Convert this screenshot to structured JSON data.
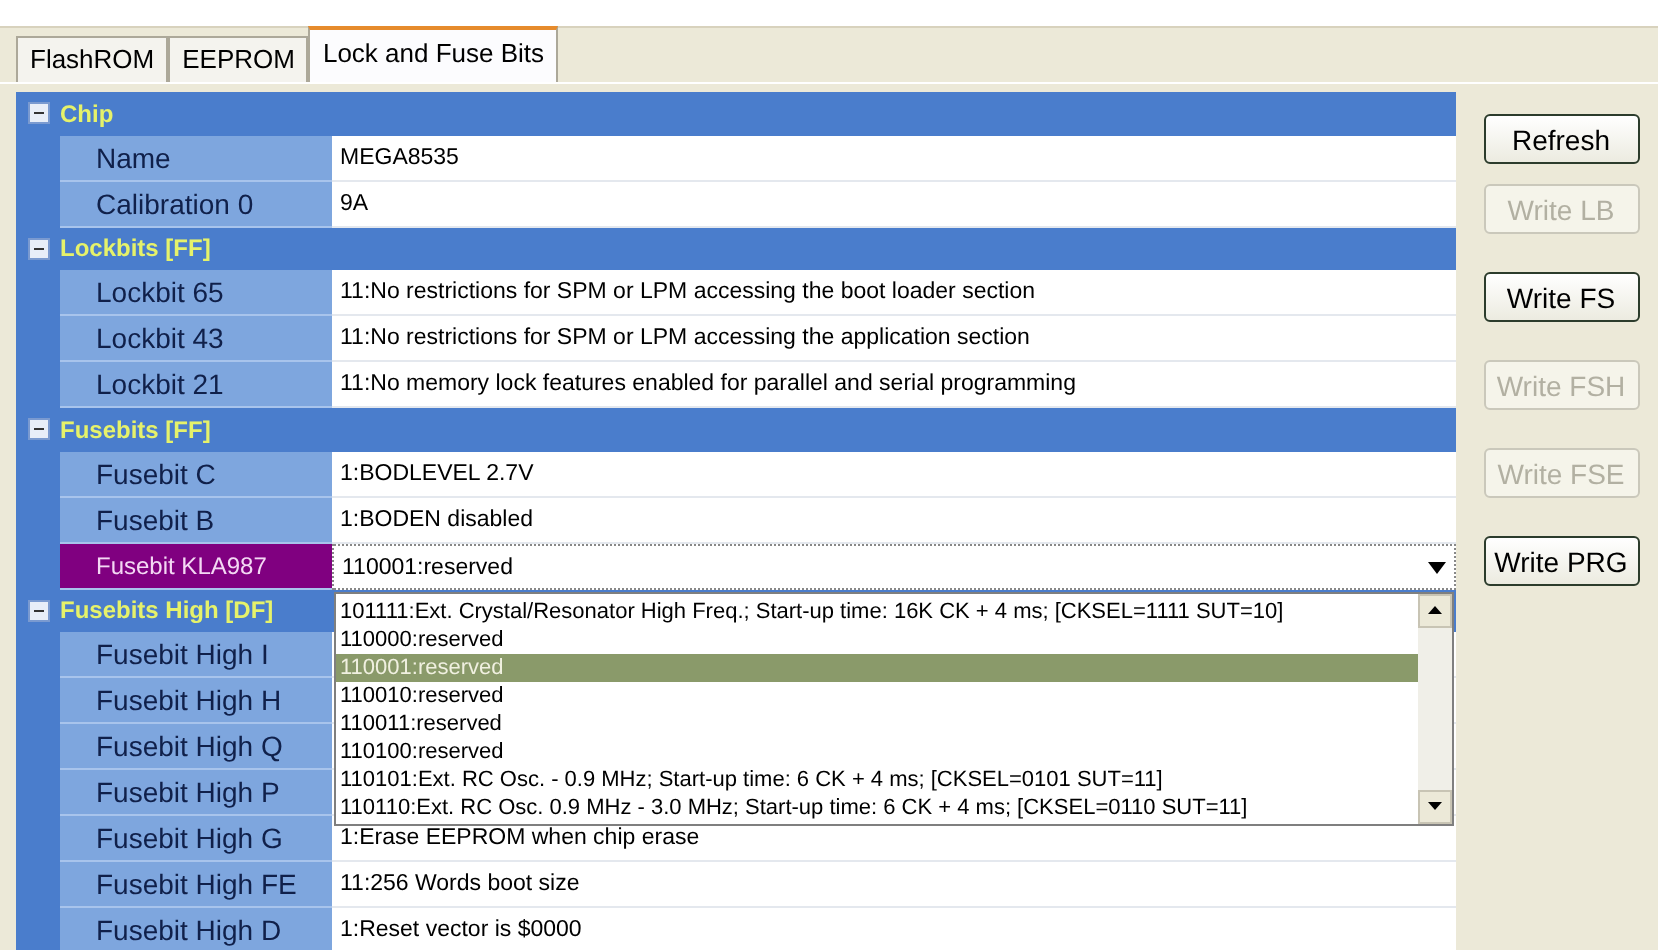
{
  "tabs": [
    {
      "label": "FlashROM",
      "selected": false
    },
    {
      "label": "EEPROM",
      "selected": false
    },
    {
      "label": "Lock and Fuse Bits",
      "selected": true
    }
  ],
  "sections": [
    {
      "title": "Chip",
      "expanded": true,
      "rows": [
        {
          "label": "Name",
          "value": "MEGA8535",
          "selected": false
        },
        {
          "label": "Calibration 0",
          "value": "9A",
          "selected": false
        }
      ]
    },
    {
      "title": "Lockbits [FF]",
      "expanded": true,
      "rows": [
        {
          "label": "Lockbit 65",
          "value": "11:No restrictions for SPM or LPM accessing the boot loader section",
          "selected": false
        },
        {
          "label": "Lockbit 43",
          "value": "11:No restrictions for SPM or LPM accessing the application section",
          "selected": false
        },
        {
          "label": "Lockbit 21",
          "value": "11:No memory lock features enabled for parallel and serial programming",
          "selected": false
        }
      ]
    },
    {
      "title": "Fusebits [FF]",
      "expanded": true,
      "rows": [
        {
          "label": "Fusebit C",
          "value": "1:BODLEVEL 2.7V",
          "selected": false
        },
        {
          "label": "Fusebit B",
          "value": "1:BODEN disabled",
          "selected": false
        },
        {
          "label": "Fusebit KLA987",
          "value": "110001:reserved",
          "selected": true,
          "dropdown": {
            "open": true,
            "options": [
              {
                "text": "101111:Ext. Crystal/Resonator High Freq.; Start-up time: 16K CK + 4 ms; [CKSEL=1111 SUT=10]",
                "selected": false
              },
              {
                "text": "110000:reserved",
                "selected": false
              },
              {
                "text": "110001:reserved",
                "selected": true
              },
              {
                "text": "110010:reserved",
                "selected": false
              },
              {
                "text": "110011:reserved",
                "selected": false
              },
              {
                "text": "110100:reserved",
                "selected": false
              },
              {
                "text": "110101:Ext. RC Osc. - 0.9 MHz; Start-up time: 6 CK + 4 ms; [CKSEL=0101 SUT=11]",
                "selected": false
              },
              {
                "text": "110110:Ext. RC Osc. 0.9 MHz - 3.0 MHz; Start-up time: 6 CK + 4 ms; [CKSEL=0110 SUT=11]",
                "selected": false
              }
            ]
          }
        }
      ]
    },
    {
      "title": "Fusebits High [DF]",
      "expanded": true,
      "rows": [
        {
          "label": "Fusebit High I",
          "selected": false
        },
        {
          "label": "Fusebit High H",
          "selected": false
        },
        {
          "label": "Fusebit High Q",
          "selected": false
        },
        {
          "label": "Fusebit High P",
          "selected": false
        },
        {
          "label": "Fusebit High G",
          "value": "1:Erase EEPROM when chip erase",
          "selected": false
        },
        {
          "label": "Fusebit High FE",
          "value": "11:256 Words boot size",
          "selected": false
        },
        {
          "label": "Fusebit High D",
          "value": "1:Reset vector is $0000",
          "selected": false
        }
      ]
    }
  ],
  "buttons": [
    {
      "label": "Refresh",
      "disabled": false
    },
    {
      "label": "Write LB",
      "disabled": true
    },
    {
      "label": "Write FS",
      "disabled": false
    },
    {
      "label": "Write FSH",
      "disabled": true
    },
    {
      "label": "Write FSE",
      "disabled": true
    },
    {
      "label": "Write PRG",
      "disabled": false
    }
  ]
}
